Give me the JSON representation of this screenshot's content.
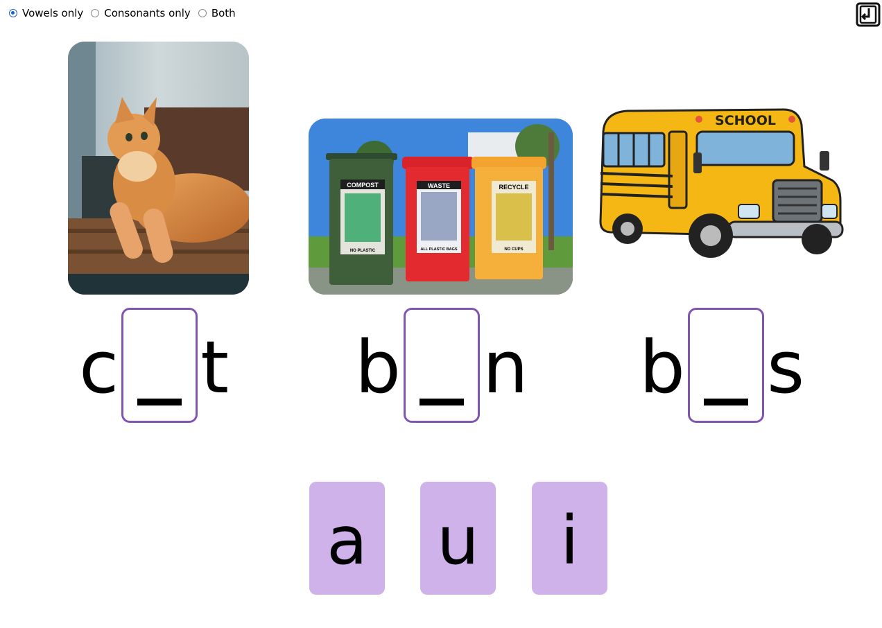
{
  "mode_options": [
    {
      "label": "Vowels only",
      "selected": true
    },
    {
      "label": "Consonants only",
      "selected": false
    },
    {
      "label": "Both",
      "selected": false
    }
  ],
  "toolbar": {
    "export_icon": "export-icon"
  },
  "words": [
    {
      "picture": "cat",
      "first": "c",
      "blank": "_",
      "last": "t"
    },
    {
      "picture": "bins",
      "first": "b",
      "blank": "_",
      "last": "n"
    },
    {
      "picture": "school-bus",
      "first": "b",
      "blank": "_",
      "last": "s"
    }
  ],
  "pictures": {
    "bins": {
      "labels": [
        "COMPOST",
        "WASTE",
        "RECYCLE"
      ],
      "sublabels": [
        "NO PLASTIC",
        "ALL PLASTIC BAGS",
        "NO CUPS"
      ]
    },
    "bus": {
      "label": "SCHOOL"
    }
  },
  "tiles": [
    {
      "letter": "a"
    },
    {
      "letter": "u"
    },
    {
      "letter": "i"
    }
  ],
  "colors": {
    "accent": "#7f55b1",
    "tile": "#cfb2ea",
    "radio_selected": "#1a5fd0"
  }
}
